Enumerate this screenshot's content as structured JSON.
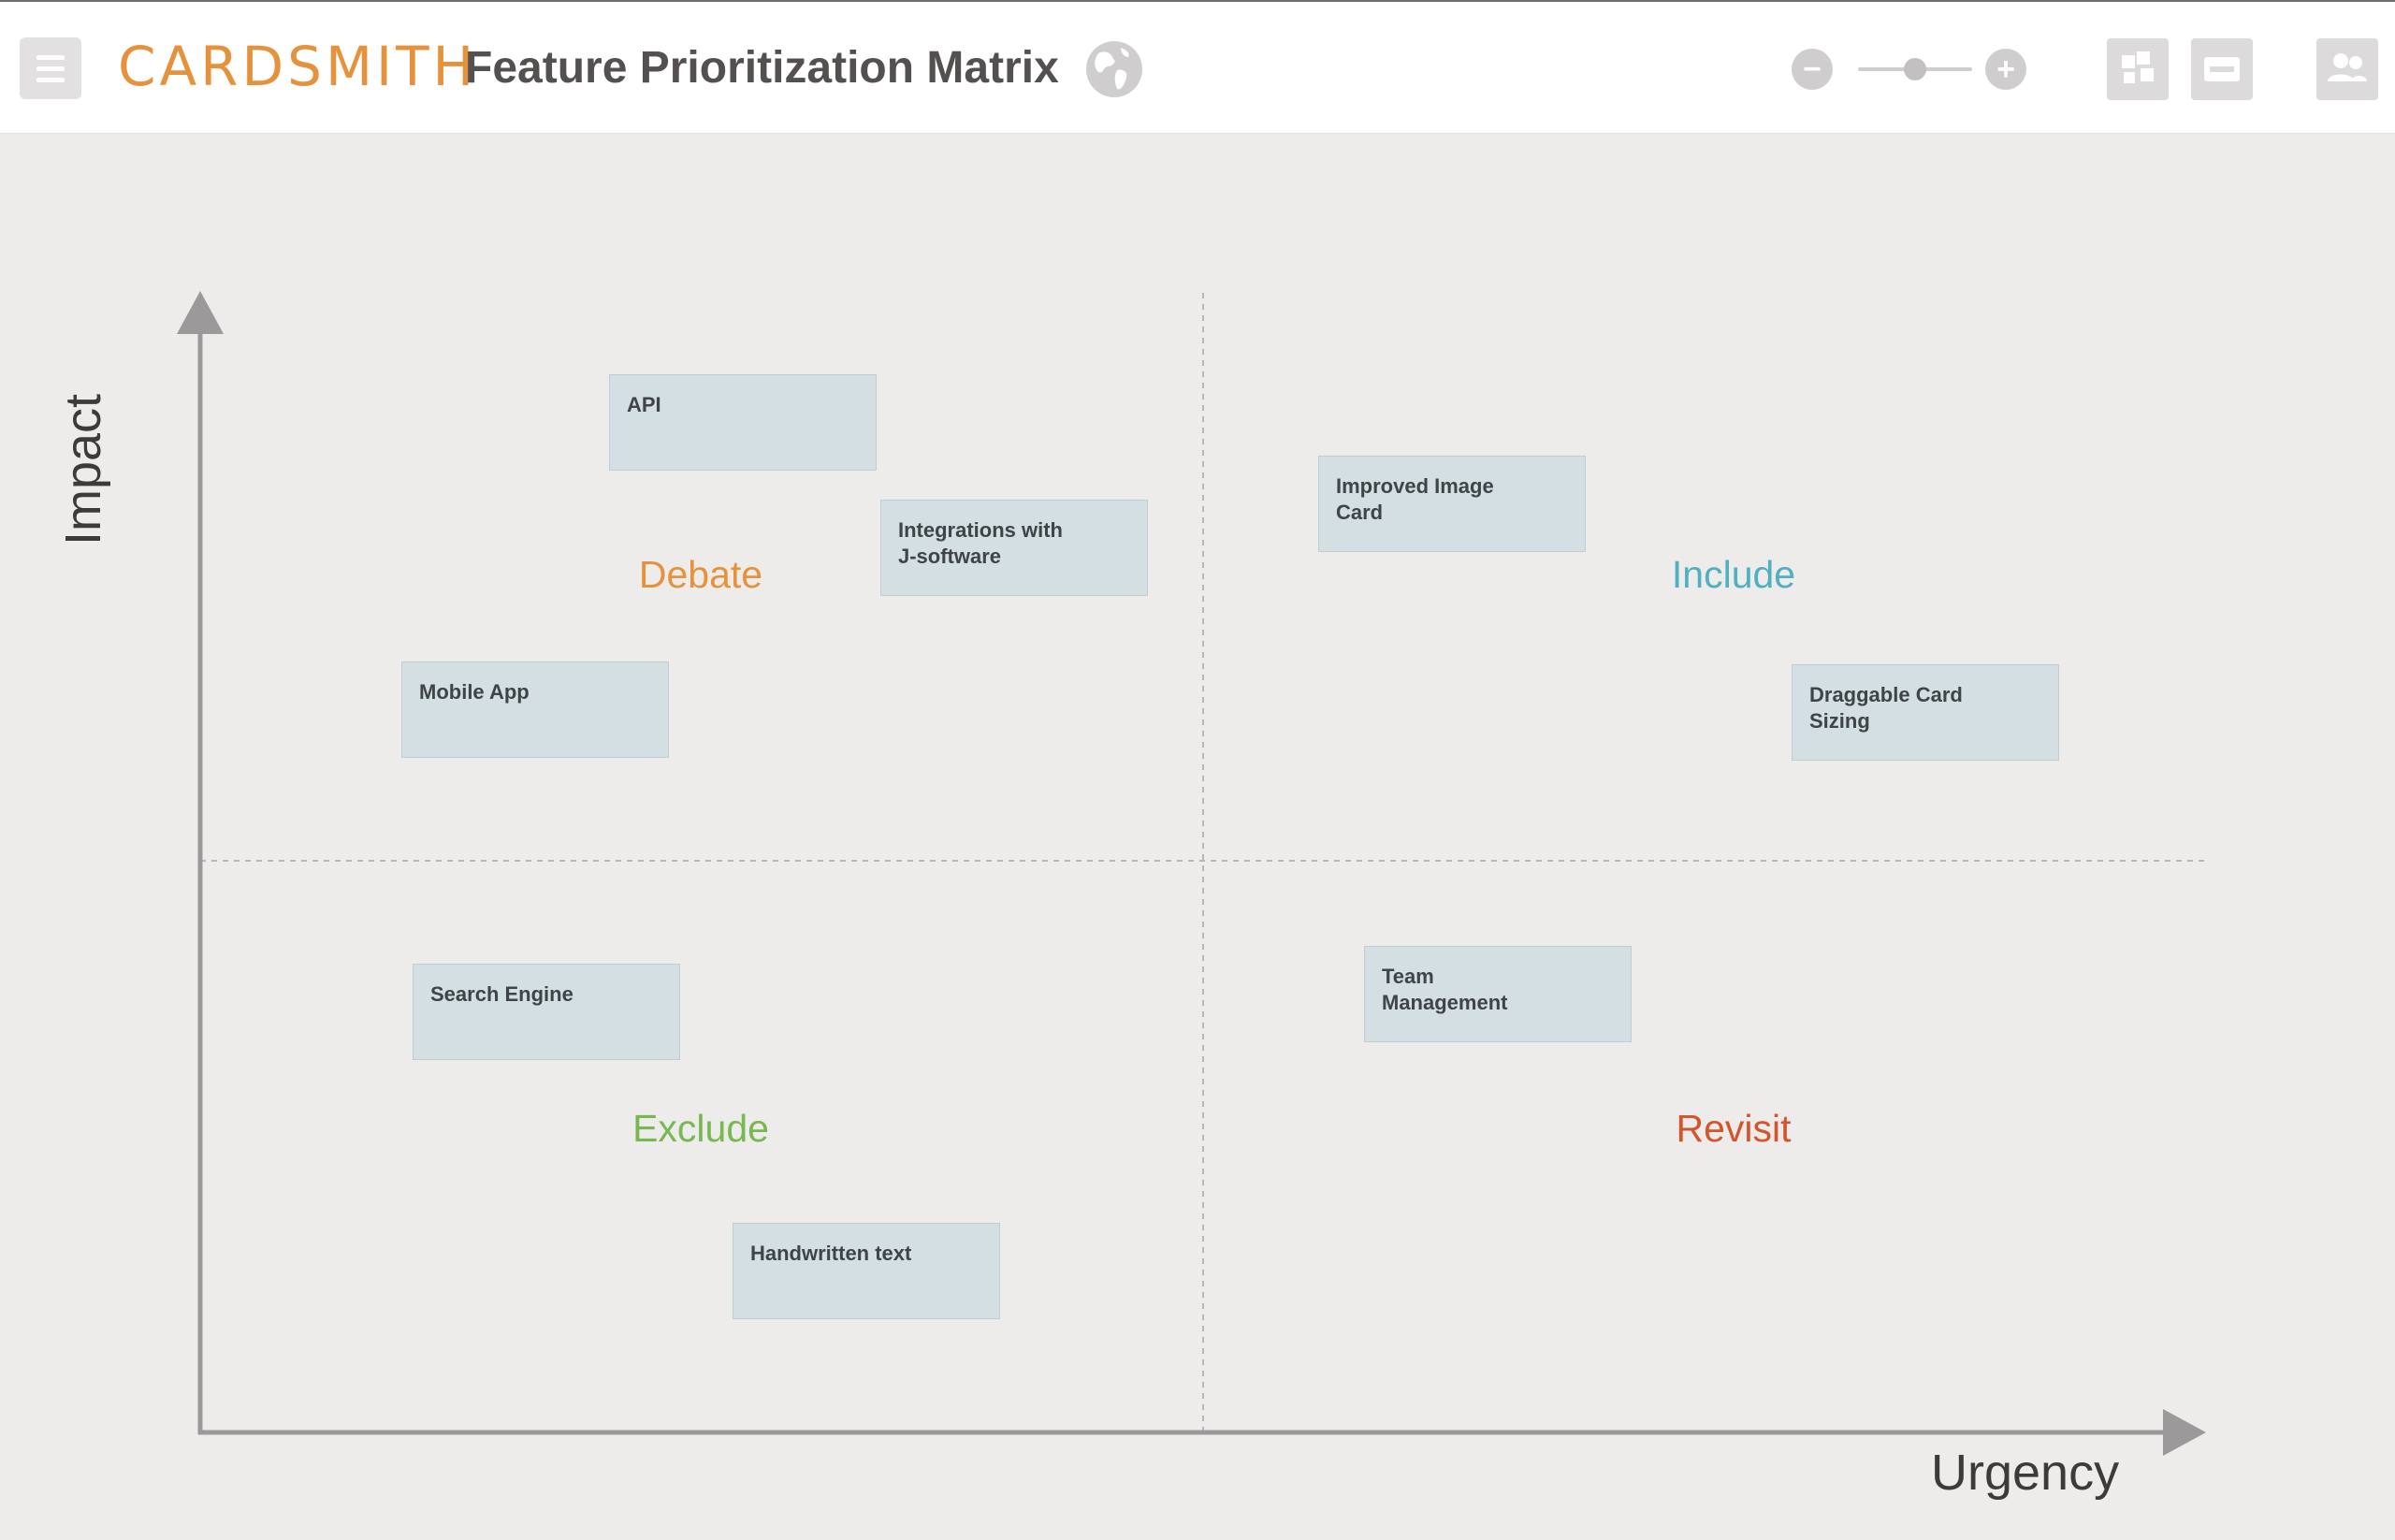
{
  "header": {
    "logo_text": "CARDSMITH",
    "board_title": "Feature Prioritization Matrix",
    "icons": {
      "menu": "hamburger-menu-icon",
      "globe": "globe-icon",
      "zoom_out": "minus-icon",
      "zoom_in": "plus-icon",
      "layout": "grid-layout-icon",
      "collapse": "minus-box-icon",
      "people": "people-icon"
    },
    "zoom_out_glyph": "−",
    "zoom_in_glyph": "+",
    "zoom_level": 0.5,
    "brand_color": "#e6923d"
  },
  "matrix": {
    "x_axis_label": "Urgency",
    "y_axis_label": "Impact",
    "quadrants": [
      {
        "name": "Debate",
        "color": "#e6923d"
      },
      {
        "name": "Include",
        "color": "#4fb0c1"
      },
      {
        "name": "Exclude",
        "color": "#77b852"
      },
      {
        "name": "Revisit",
        "color": "#d4542b"
      }
    ],
    "cards": [
      {
        "text": "API"
      },
      {
        "text": "Integrations with\nJ-software"
      },
      {
        "text": "Mobile App"
      },
      {
        "text": "Improved Image\nCard"
      },
      {
        "text": "Draggable Card\nSizing"
      },
      {
        "text": "Search Engine"
      },
      {
        "text": "Handwritten text"
      },
      {
        "text": "Team\nManagement"
      }
    ]
  }
}
